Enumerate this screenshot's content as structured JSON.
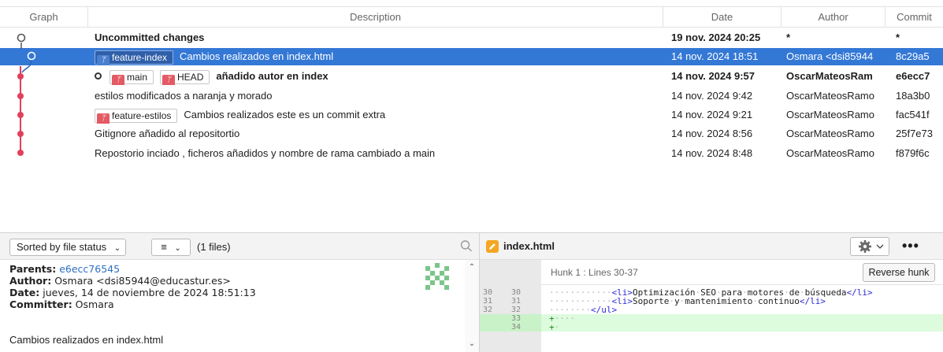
{
  "columns": {
    "graph": "Graph",
    "description": "Description",
    "date": "Date",
    "author": "Author",
    "commit": "Commit"
  },
  "commits": [
    {
      "description": "Uncommitted changes",
      "date": "19 nov. 2024 20:25",
      "author": "*",
      "hash": "*",
      "tags": []
    },
    {
      "description": "Cambios realizados en index.html",
      "date": "14 nov. 2024 18:51",
      "author": "Osmara <dsi85944",
      "hash": "8c29a5",
      "tags": [
        "feature-index"
      ],
      "selected": true
    },
    {
      "description": "añadido autor en index",
      "date": "14 nov. 2024 9:57",
      "author": "OscarMateosRam",
      "hash": "e6ecc7",
      "tags": [
        "main",
        "HEAD"
      ],
      "head": true
    },
    {
      "description": "estilos modificados a naranja y morado",
      "date": "14 nov. 2024 9:42",
      "author": "OscarMateosRamo",
      "hash": "18a3b0",
      "tags": []
    },
    {
      "description": "Cambios realizados este es un commit extra",
      "date": "14 nov. 2024 9:21",
      "author": "OscarMateosRamo",
      "hash": "fac541f",
      "tags": [
        "feature-estilos"
      ]
    },
    {
      "description": "Gitignore añadido al repositortio",
      "date": "14 nov. 2024 8:56",
      "author": "OscarMateosRamo",
      "hash": "25f7e73",
      "tags": []
    },
    {
      "description": "Repostorio inciado , ficheros añadidos y nombre de rama cambiado a main",
      "date": "14 nov. 2024 8:48",
      "author": "OscarMateosRamo",
      "hash": "f879f6c",
      "tags": []
    }
  ],
  "details": {
    "sort_label": "Sorted by file status",
    "files_count": "(1 files)",
    "parents_label": "Parents:",
    "parents_value": "e6ecc76545",
    "author_label": "Author:",
    "author_value": "Osmara <dsi85944@educastur.es>",
    "date_label": "Date:",
    "date_value": "jueves, 14 de noviembre de 2024 18:51:13",
    "committer_label": "Committer:",
    "committer_value": "Osmara",
    "message": "Cambios realizados en index.html"
  },
  "diff": {
    "file_name": "index.html",
    "hunk_label": "Hunk 1 : Lines 30-37",
    "reverse_label": "Reverse hunk",
    "lines": [
      {
        "old": "30",
        "new": "30",
        "text": "············<li>Optimización·SEO·para·motores·de·búsqueda</li>",
        "type": "ctx"
      },
      {
        "old": "31",
        "new": "31",
        "text": "············<li>Soporte·y·mantenimiento·continuo</li>",
        "type": "ctx"
      },
      {
        "old": "32",
        "new": "32",
        "text": "········</ul>",
        "type": "ctx"
      },
      {
        "old": "",
        "new": "33",
        "text": "+····",
        "type": "add"
      },
      {
        "old": "",
        "new": "34",
        "text": "+·",
        "type": "add"
      }
    ]
  },
  "colors": {
    "selection": "#3478d6",
    "branch": "#e2405a",
    "graph_gray": "#555555",
    "added_line": "#ddfbdd"
  }
}
